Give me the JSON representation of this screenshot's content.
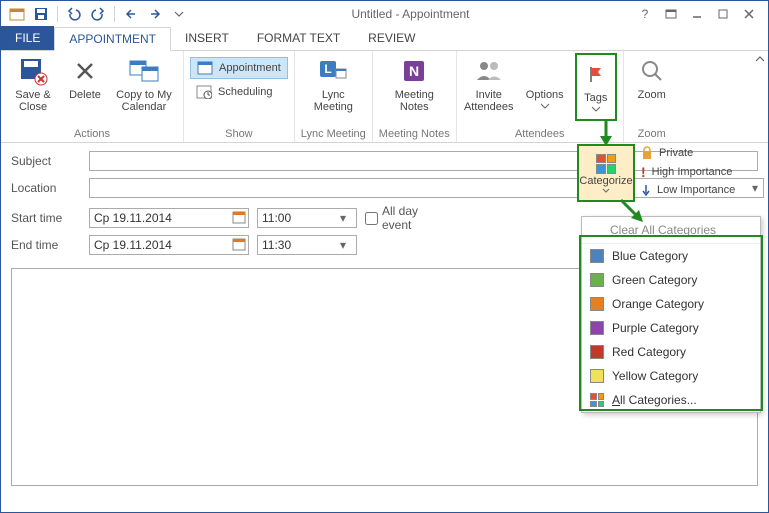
{
  "window": {
    "title": "Untitled - Appointment"
  },
  "tabs": {
    "file": "FILE",
    "appointment": "APPOINTMENT",
    "insert": "INSERT",
    "format": "FORMAT TEXT",
    "review": "REVIEW"
  },
  "ribbon": {
    "actions": {
      "save_close": "Save & Close",
      "delete": "Delete",
      "copy": "Copy to My Calendar",
      "group": "Actions"
    },
    "show": {
      "appointment": "Appointment",
      "scheduling": "Scheduling",
      "group": "Show"
    },
    "lync": {
      "btn": "Lync Meeting",
      "group": "Lync Meeting"
    },
    "notes": {
      "btn": "Meeting Notes",
      "group": "Meeting Notes"
    },
    "attendees": {
      "invite": "Invite Attendees",
      "options": "Options",
      "tags": "Tags",
      "group": "Attendees"
    },
    "zoom": {
      "btn": "Zoom",
      "group": "Zoom"
    }
  },
  "form": {
    "subject_label": "Subject",
    "subject": "",
    "location_label": "Location",
    "location": "",
    "start_label": "Start time",
    "start_date": "Cp 19.11.2014",
    "start_time": "11:00",
    "end_label": "End time",
    "end_date": "Cp 19.11.2014",
    "end_time": "11:30",
    "allday": "All day event"
  },
  "tagspanel": {
    "categorize": "Categorize",
    "private": "Private",
    "high": "High Importance",
    "low": "Low Importance"
  },
  "catmenu": {
    "clear": "Clear All Categories",
    "blue": "Blue Category",
    "green": "Green Category",
    "orange": "Orange Category",
    "purple": "Purple Category",
    "red": "Red Category",
    "yellow": "Yellow Category",
    "all": "All Categories..."
  }
}
